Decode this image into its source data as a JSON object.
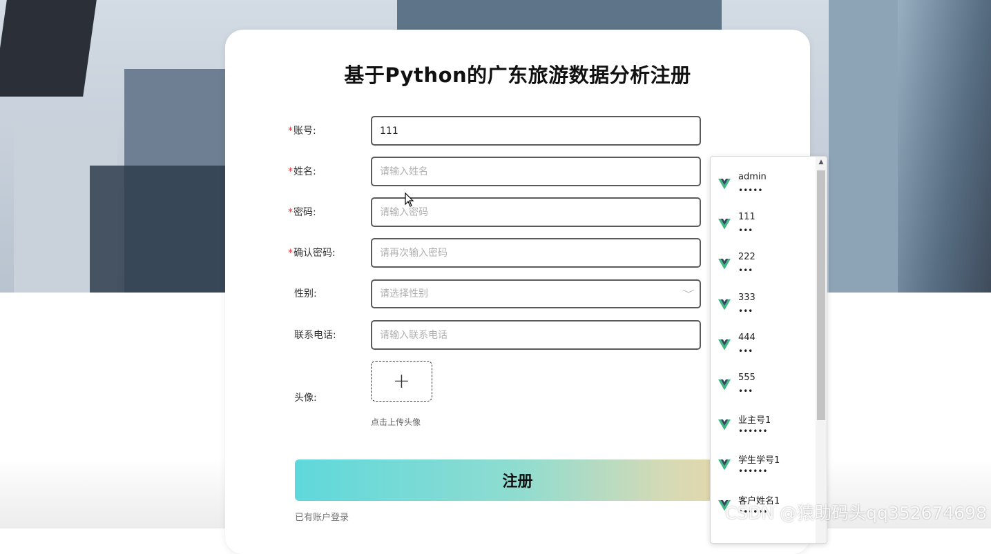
{
  "page": {
    "title": "基于Python的广东旅游数据分析注册"
  },
  "form": {
    "fields": [
      {
        "key": "account",
        "label": "账号:",
        "required": true,
        "value": "111",
        "placeholder": ""
      },
      {
        "key": "name",
        "label": "姓名:",
        "required": true,
        "value": "",
        "placeholder": "请输入姓名"
      },
      {
        "key": "password",
        "label": "密码:",
        "required": true,
        "value": "",
        "placeholder": "请输入密码"
      },
      {
        "key": "confirm",
        "label": "确认密码:",
        "required": true,
        "value": "",
        "placeholder": "请再次输入密码"
      },
      {
        "key": "gender",
        "label": "性别:",
        "required": false,
        "value": "",
        "placeholder": "请选择性别"
      },
      {
        "key": "phone",
        "label": "联系电话:",
        "required": false,
        "value": "",
        "placeholder": "请输入联系电话"
      }
    ],
    "required_mark": "*",
    "avatar": {
      "label": "头像:",
      "plus": "+",
      "hint": "点击上传头像"
    },
    "submit_label": "注册",
    "login_link": "已有账户登录"
  },
  "autocomplete": {
    "icon": "vue-logo-icon",
    "items": [
      {
        "user": "admin",
        "pwd": "•••••"
      },
      {
        "user": "111",
        "pwd": "•••"
      },
      {
        "user": "222",
        "pwd": "•••"
      },
      {
        "user": "333",
        "pwd": "•••"
      },
      {
        "user": "444",
        "pwd": "•••"
      },
      {
        "user": "555",
        "pwd": "•••"
      },
      {
        "user": "业主号1",
        "pwd": "••••••"
      },
      {
        "user": "学生学号1",
        "pwd": "••••••"
      },
      {
        "user": "客户姓名1",
        "pwd": "••••••"
      }
    ],
    "scroll_up": "▲"
  },
  "colors": {
    "required": "#e0373b",
    "vue_green": "#41b883",
    "vue_dark": "#35495e"
  },
  "watermark": "CSDN @猿助码头qq352674698"
}
